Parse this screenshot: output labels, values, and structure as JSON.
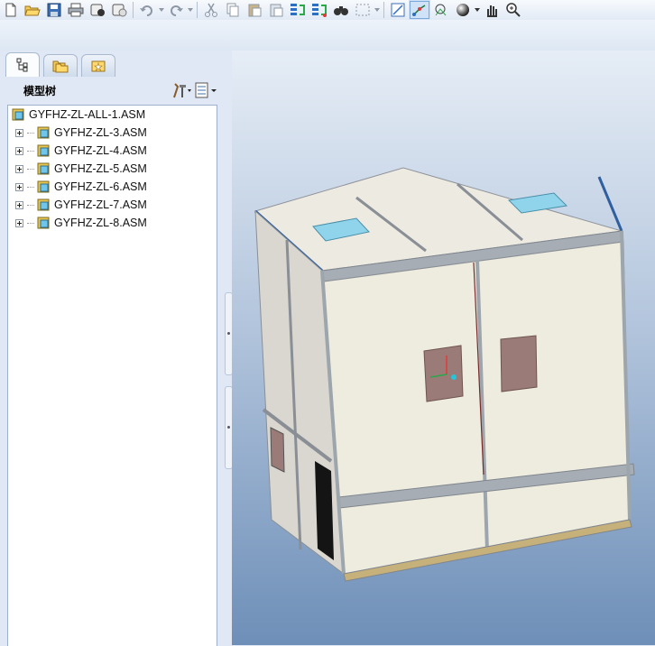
{
  "toolbar": {
    "buttons": [
      {
        "name": "new-file-icon"
      },
      {
        "name": "open-folder-icon"
      },
      {
        "name": "save-icon"
      },
      {
        "name": "print-icon"
      },
      {
        "name": "send-mail-icon"
      },
      {
        "name": "close-window-icon"
      },
      {
        "name": "undo-icon"
      },
      {
        "name": "redo-icon"
      },
      {
        "name": "cut-icon"
      },
      {
        "name": "copy-icon"
      },
      {
        "name": "paste-icon"
      },
      {
        "name": "paste-special-icon"
      },
      {
        "name": "regenerate-icon"
      },
      {
        "name": "regenerate-manager-icon"
      },
      {
        "name": "find-icon"
      },
      {
        "name": "select-box-icon"
      },
      {
        "name": "datum-plane-icon"
      },
      {
        "name": "datum-axis-icon"
      },
      {
        "name": "datum-point-icon"
      },
      {
        "name": "shading-sphere-icon"
      },
      {
        "name": "pan-hand-icon"
      },
      {
        "name": "zoom-in-icon"
      }
    ]
  },
  "panel": {
    "tabs": [
      {
        "name": "model-tree-tab-icon",
        "active": true
      },
      {
        "name": "folder-browser-tab-icon",
        "active": false
      },
      {
        "name": "favorites-tab-icon",
        "active": false
      }
    ],
    "title": "模型树",
    "settings_icon": "tree-settings-icon",
    "columns_icon": "tree-columns-icon"
  },
  "tree": {
    "root": "GYFHZ-ZL-ALL-1.ASM",
    "children": [
      "GYFHZ-ZL-3.ASM",
      "GYFHZ-ZL-4.ASM",
      "GYFHZ-ZL-5.ASM",
      "GYFHZ-ZL-6.ASM",
      "GYFHZ-ZL-7.ASM",
      "GYFHZ-ZL-8.ASM"
    ]
  },
  "viewport": {
    "model": "switchgear-cabinet-assembly",
    "colors": {
      "panel": "#eeebdf",
      "frame": "#9da5ad",
      "window": "#9b7b77",
      "vent": "#8fd4ea",
      "edge_blue": "#2f5f9e"
    }
  }
}
